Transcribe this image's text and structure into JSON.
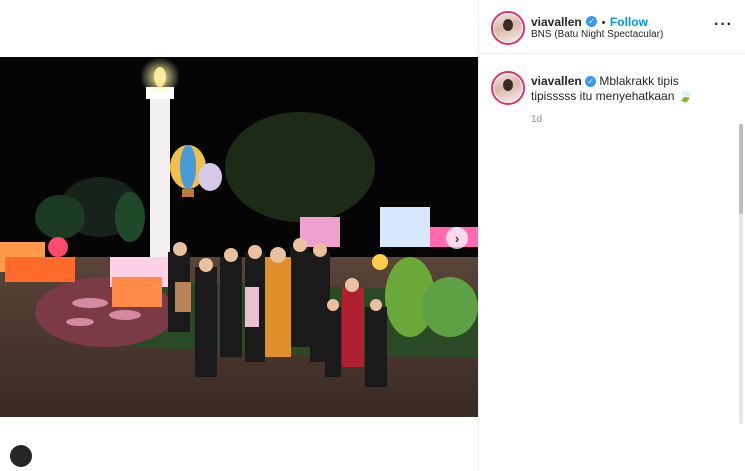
{
  "post": {
    "username": "viavallen",
    "follow_label": "Follow",
    "location": "BNS (Batu Night Spectacular)",
    "caption": "Mblakrakk tipis tipisssss itu menyehatkaan",
    "caption_emoji": "🍃",
    "time": "1d",
    "separator": "•",
    "verified_mark": "✓"
  },
  "colors": {
    "follow": "#0095f6",
    "verified": "#3897f0",
    "story_ring": "#e1306c"
  },
  "icons": {
    "more": "more-options-icon",
    "next": "chevron-right-icon"
  }
}
